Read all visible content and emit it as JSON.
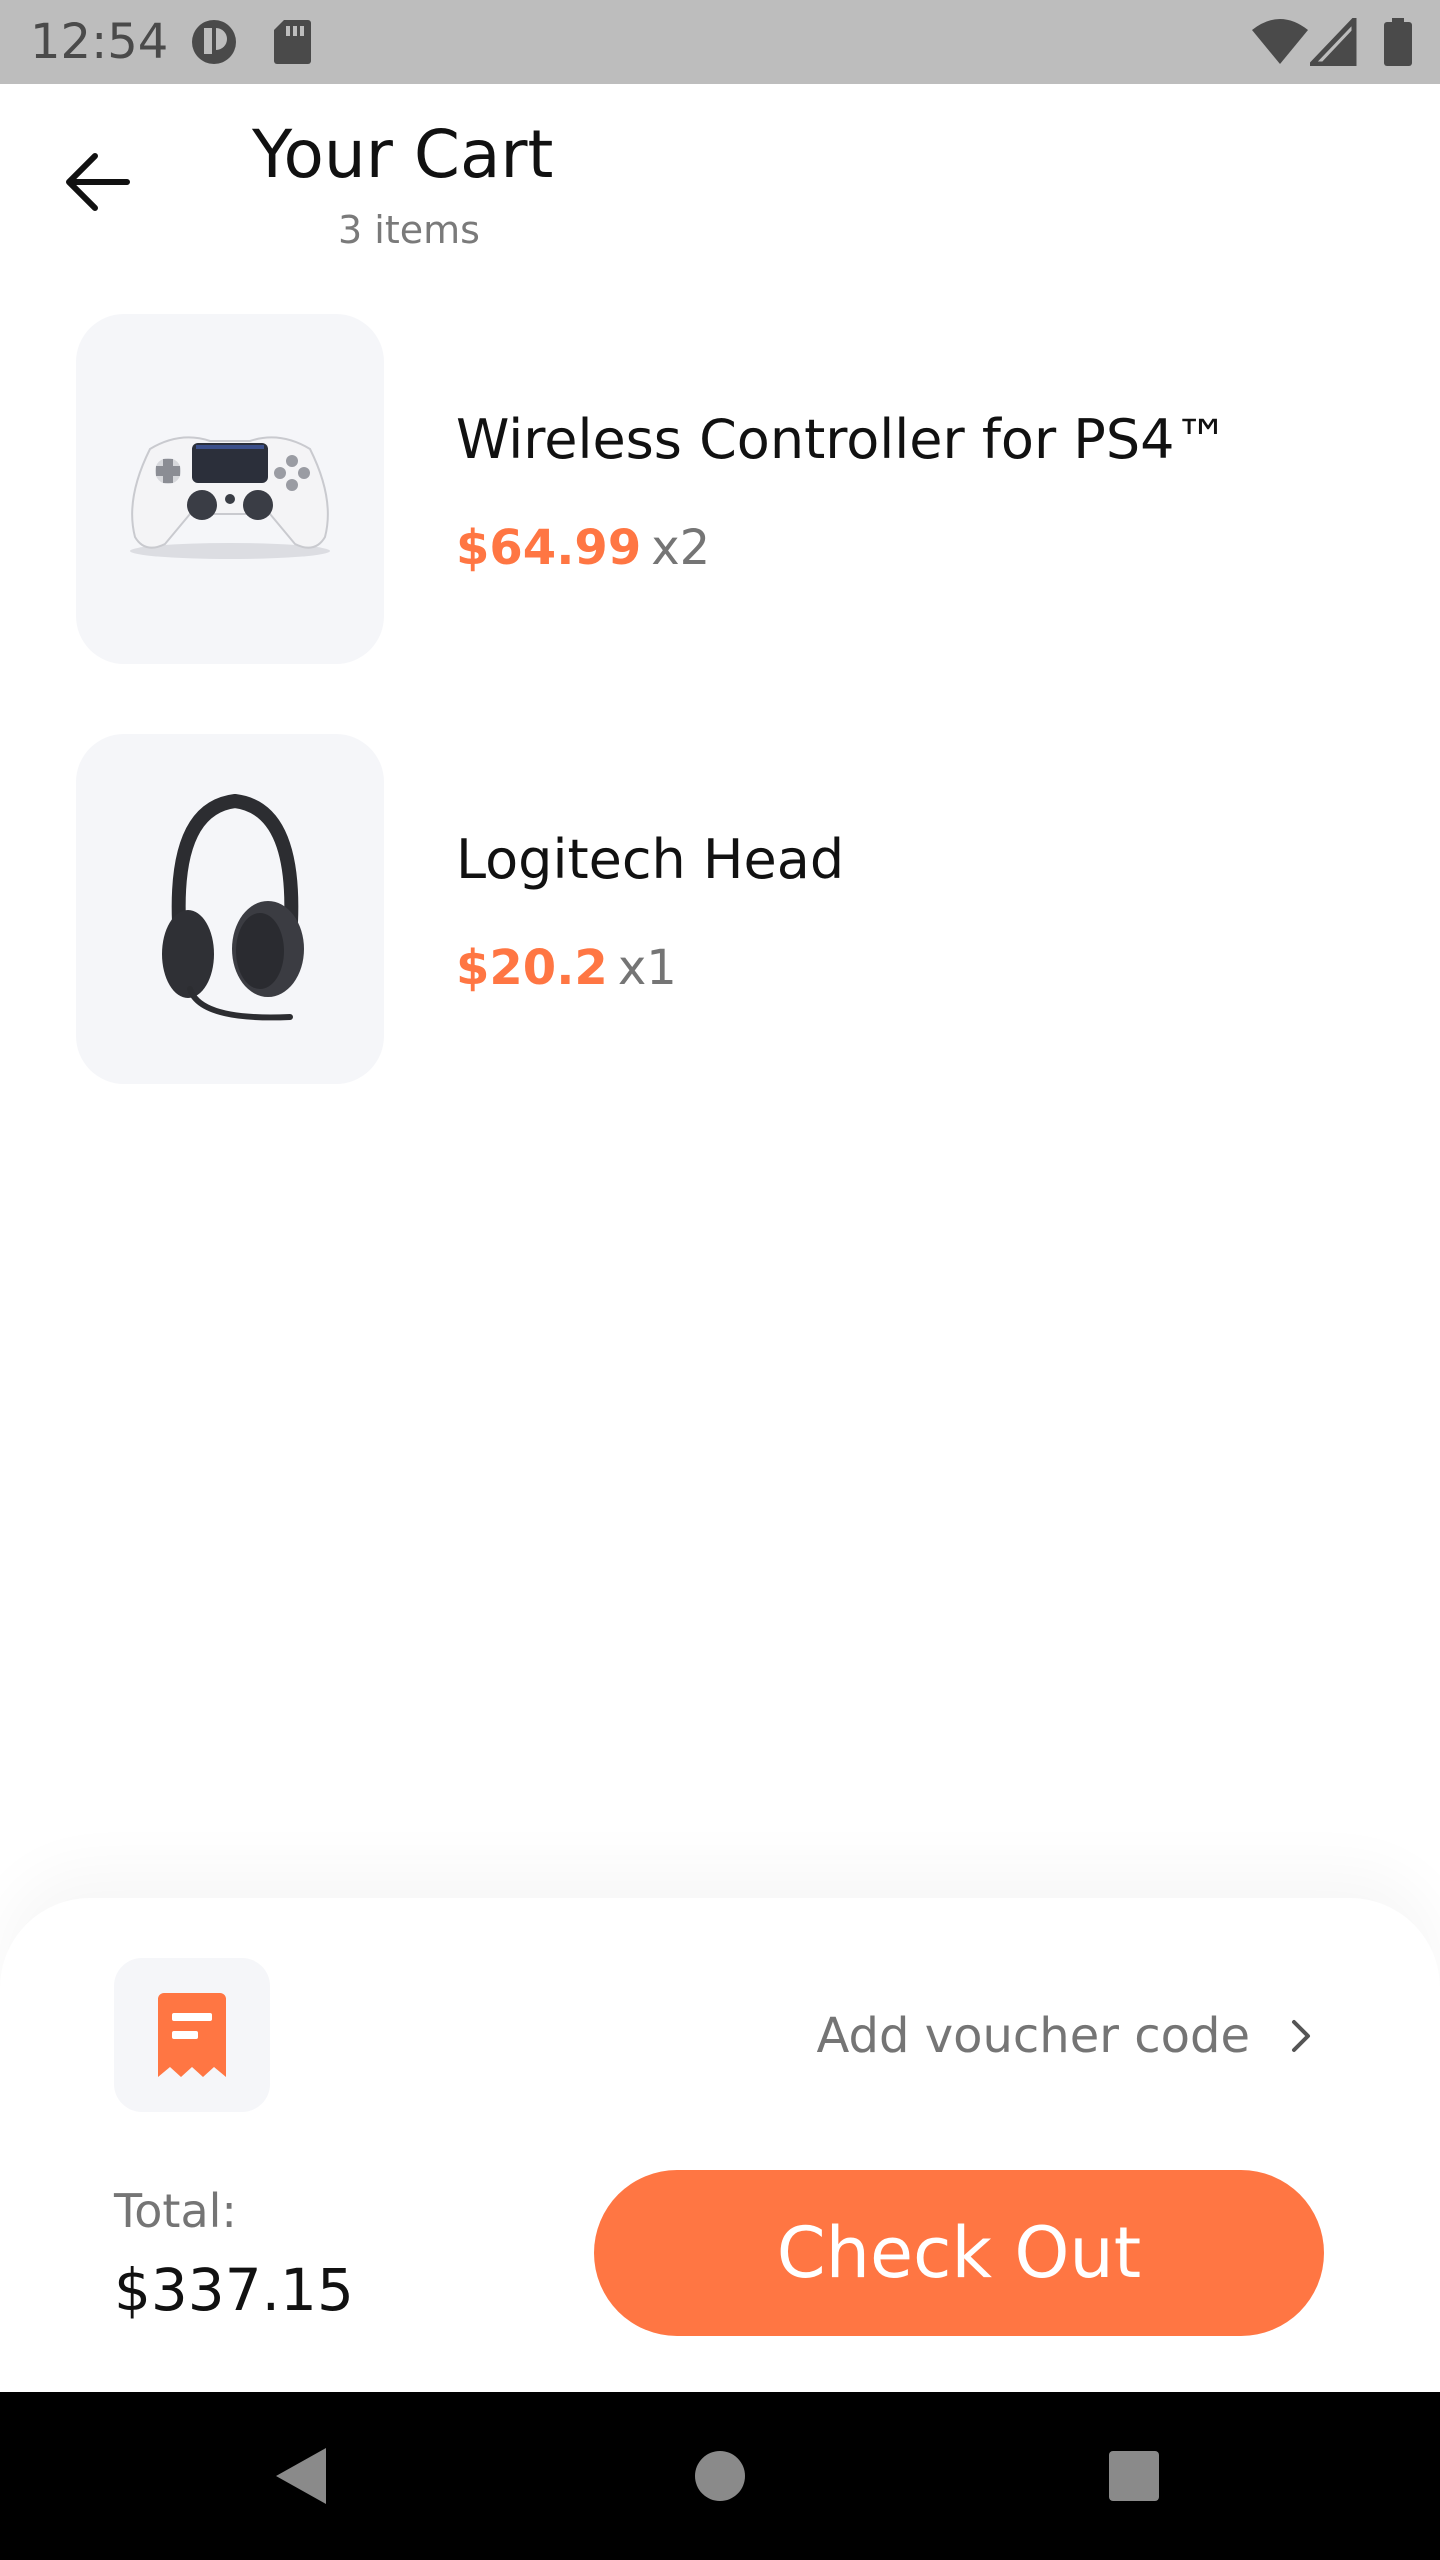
{
  "status_bar": {
    "time": "12:54",
    "icons": [
      "notification-icon",
      "sd-card-icon",
      "wifi-icon",
      "signal-icon",
      "battery-icon"
    ]
  },
  "header": {
    "back_icon": "arrow-left-icon",
    "title": "Your Cart",
    "subtitle": "3 items"
  },
  "cart": {
    "items": [
      {
        "name": "Wireless Controller for PS4™",
        "price": "$64.99",
        "quantity": "x2",
        "image": "game-controller-image"
      },
      {
        "name": "Logitech Head",
        "price": "$20.2",
        "quantity": "x1",
        "image": "headphones-image"
      }
    ]
  },
  "checkout_panel": {
    "voucher_icon": "receipt-icon",
    "voucher_label": "Add voucher code",
    "total_label": "Total:",
    "total_value": "$337.15",
    "checkout_label": "Check Out"
  },
  "nav_bar": {
    "buttons": [
      "back-triangle-icon",
      "home-circle-icon",
      "recents-square-icon"
    ]
  },
  "colors": {
    "accent": "#ff7643",
    "thumb_bg": "#f5f6f9",
    "status_bar": "#bdbdbd"
  }
}
